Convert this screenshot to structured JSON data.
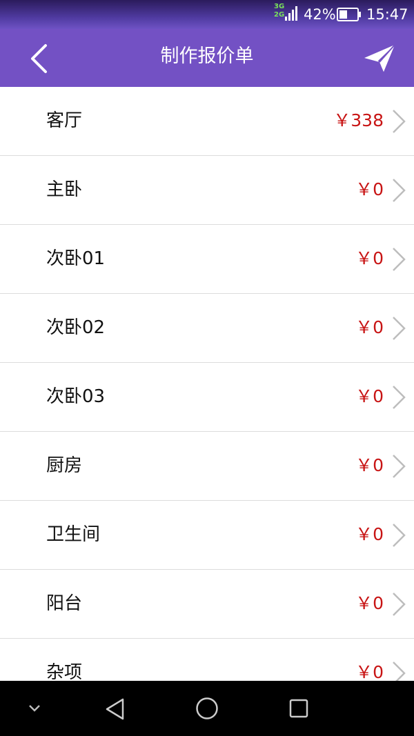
{
  "status_bar": {
    "network_top": "3G",
    "network_bottom": "2G",
    "battery_percent": "42%",
    "time": "15:47"
  },
  "app_bar": {
    "title": "制作报价单",
    "back_icon": "chevron-left-icon",
    "action_icon": "paper-plane-icon"
  },
  "rooms": [
    {
      "name": "客厅",
      "price": "￥338"
    },
    {
      "name": "主卧",
      "price": "￥0"
    },
    {
      "name": "次卧01",
      "price": "￥0"
    },
    {
      "name": "次卧02",
      "price": "￥0"
    },
    {
      "name": "次卧03",
      "price": "￥0"
    },
    {
      "name": "厨房",
      "price": "￥0"
    },
    {
      "name": "卫生间",
      "price": "￥0"
    },
    {
      "name": "阳台",
      "price": "￥0"
    },
    {
      "name": "杂项",
      "price": "￥0"
    }
  ],
  "nav_bar": {
    "icons": [
      "chevron-down-icon",
      "back-triangle-icon",
      "home-circle-icon",
      "recents-square-icon"
    ]
  },
  "colors": {
    "app_bar": "#7351c4",
    "price": "#c81414",
    "divider": "#dcdcdc"
  }
}
